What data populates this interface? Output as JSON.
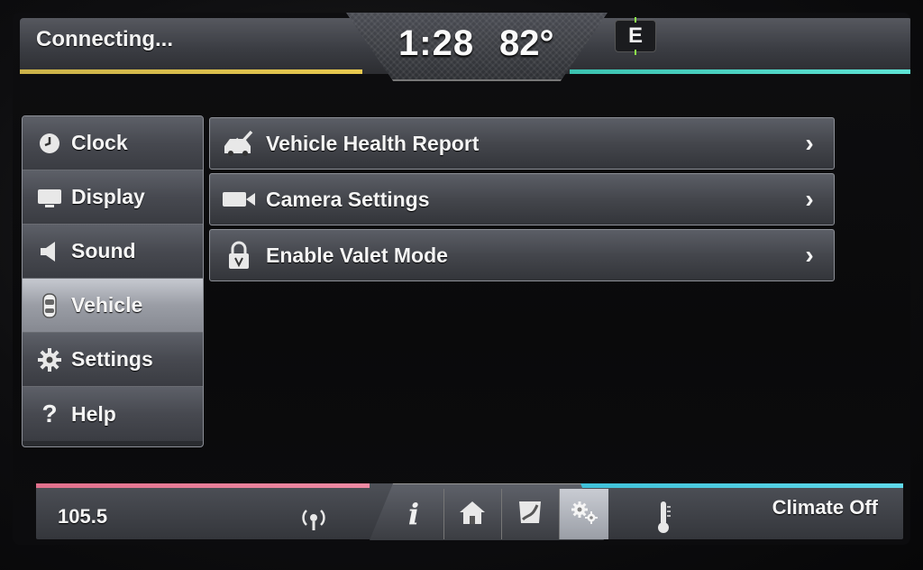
{
  "topbar": {
    "status": "Connecting...",
    "time": "1:28",
    "temperature": "82°",
    "compass": "E"
  },
  "menu": {
    "items": [
      {
        "label": "Clock",
        "icon": "clock-icon",
        "active": false
      },
      {
        "label": "Display",
        "icon": "display-icon",
        "active": false
      },
      {
        "label": "Sound",
        "icon": "speaker-icon",
        "active": false
      },
      {
        "label": "Vehicle",
        "icon": "car-icon",
        "active": true
      },
      {
        "label": "Settings",
        "icon": "gear-icon",
        "active": false
      },
      {
        "label": "Help",
        "icon": "question-icon",
        "active": false
      }
    ]
  },
  "list": {
    "rows": [
      {
        "label": "Vehicle Health Report",
        "icon": "health-report-icon"
      },
      {
        "label": "Camera Settings",
        "icon": "camera-icon"
      },
      {
        "label": "Enable Valet Mode",
        "icon": "lock-icon"
      }
    ]
  },
  "bottombar": {
    "radio_frequency": "105.5",
    "climate_status": "Climate Off",
    "tabs": [
      {
        "name": "info",
        "icon": "info-icon",
        "active": false
      },
      {
        "name": "home",
        "icon": "home-icon",
        "active": false
      },
      {
        "name": "navigation",
        "icon": "map-icon",
        "active": false
      },
      {
        "name": "settings",
        "icon": "gears-icon",
        "active": true
      }
    ]
  },
  "colors": {
    "top_left_accent": "#e8c94f",
    "top_right_accent": "#5fe4d6",
    "bottom_left_accent": "#ee8aa3",
    "bottom_right_accent": "#5fd9ea"
  }
}
